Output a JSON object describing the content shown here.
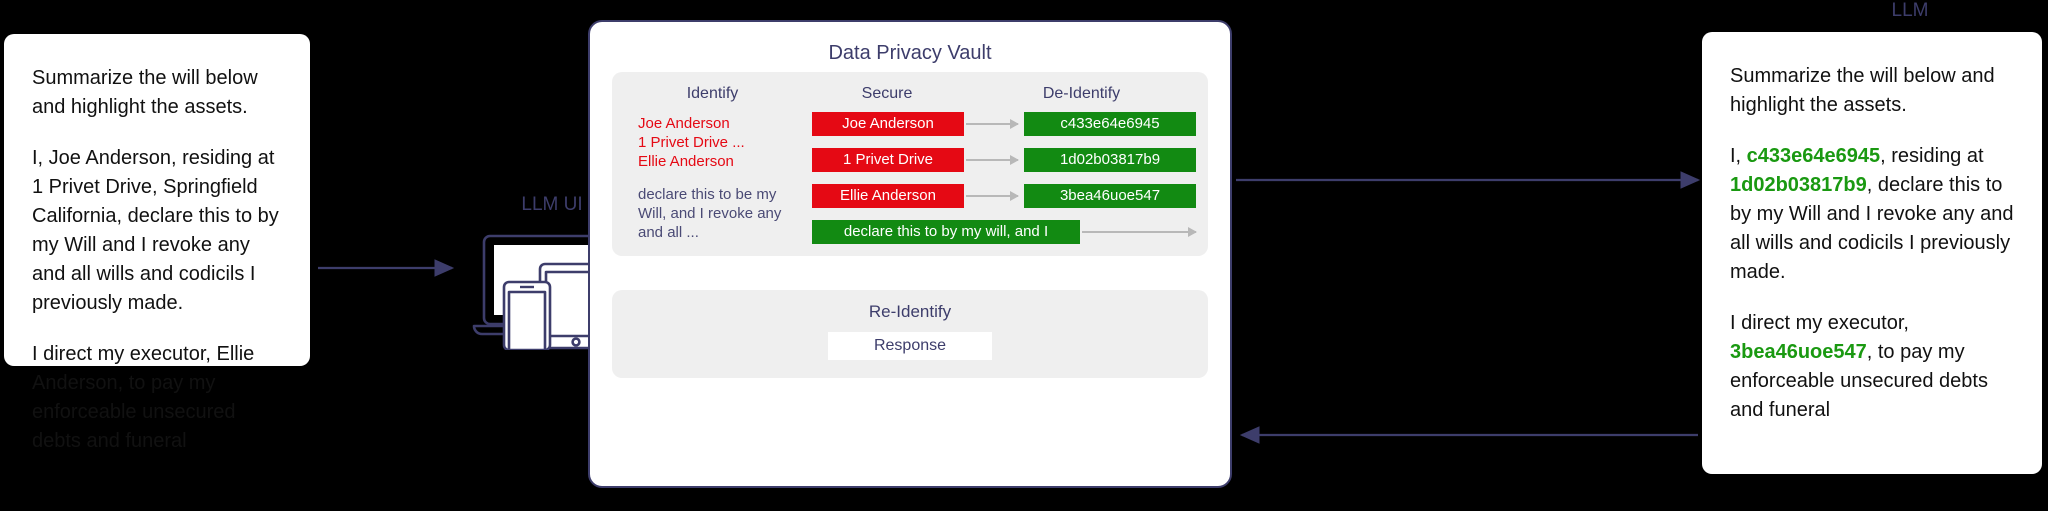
{
  "prompt_card": {
    "paragraphs": [
      "Summarize the will below and highlight the assets.",
      "I, Joe Anderson, residing at 1 Privet Drive, Springfield California, declare this to by my Will and I revoke any and all wills and codicils I previously made.",
      "I direct my executor, Ellie Anderson, to pay my enforceable unsecured debts and funeral"
    ]
  },
  "response_card": {
    "p1": "Summarize the will below and highlight the assets.",
    "p2_a": "I, ",
    "p2_tok1": "c433e64e6945",
    "p2_b": ", residing at ",
    "p2_tok2": "1d02b03817b9",
    "p2_c": ", declare this to by my Will and I revoke any and all wills and codicils I previously made.",
    "p3_a": "I direct my executor, ",
    "p3_tok3": "3bea46uoe547",
    "p3_b": ", to pay my enforceable unsecured debts and funeral"
  },
  "llm_ui": {
    "label": "LLM UI"
  },
  "llm": {
    "label": "LLM"
  },
  "vault": {
    "title": "Data Privacy Vault",
    "columns": {
      "identify": "Identify",
      "secure": "Secure",
      "deidentify": "De-Identify"
    },
    "identify_pii": "Joe Anderson\n1 Privet Drive ...\nEllie Anderson",
    "identify_text": "declare this to be my Will, and I revoke any and all ...",
    "secure_chips": [
      "Joe Anderson",
      "1 Privet Drive",
      "Ellie Anderson",
      "declare this to by my will, and I"
    ],
    "deidentify_chips": [
      "c433e64e6945",
      "1d02b03817b9",
      "3bea46uoe547"
    ],
    "reidentify": {
      "title": "Re-Identify",
      "response": "Response"
    }
  },
  "colors": {
    "navy": "#3d3d6b",
    "red": "#e50914",
    "green": "#128a12",
    "token_green": "#1a9911",
    "panel_grey": "#efefef",
    "arrow_grey": "#b8b8b8"
  }
}
